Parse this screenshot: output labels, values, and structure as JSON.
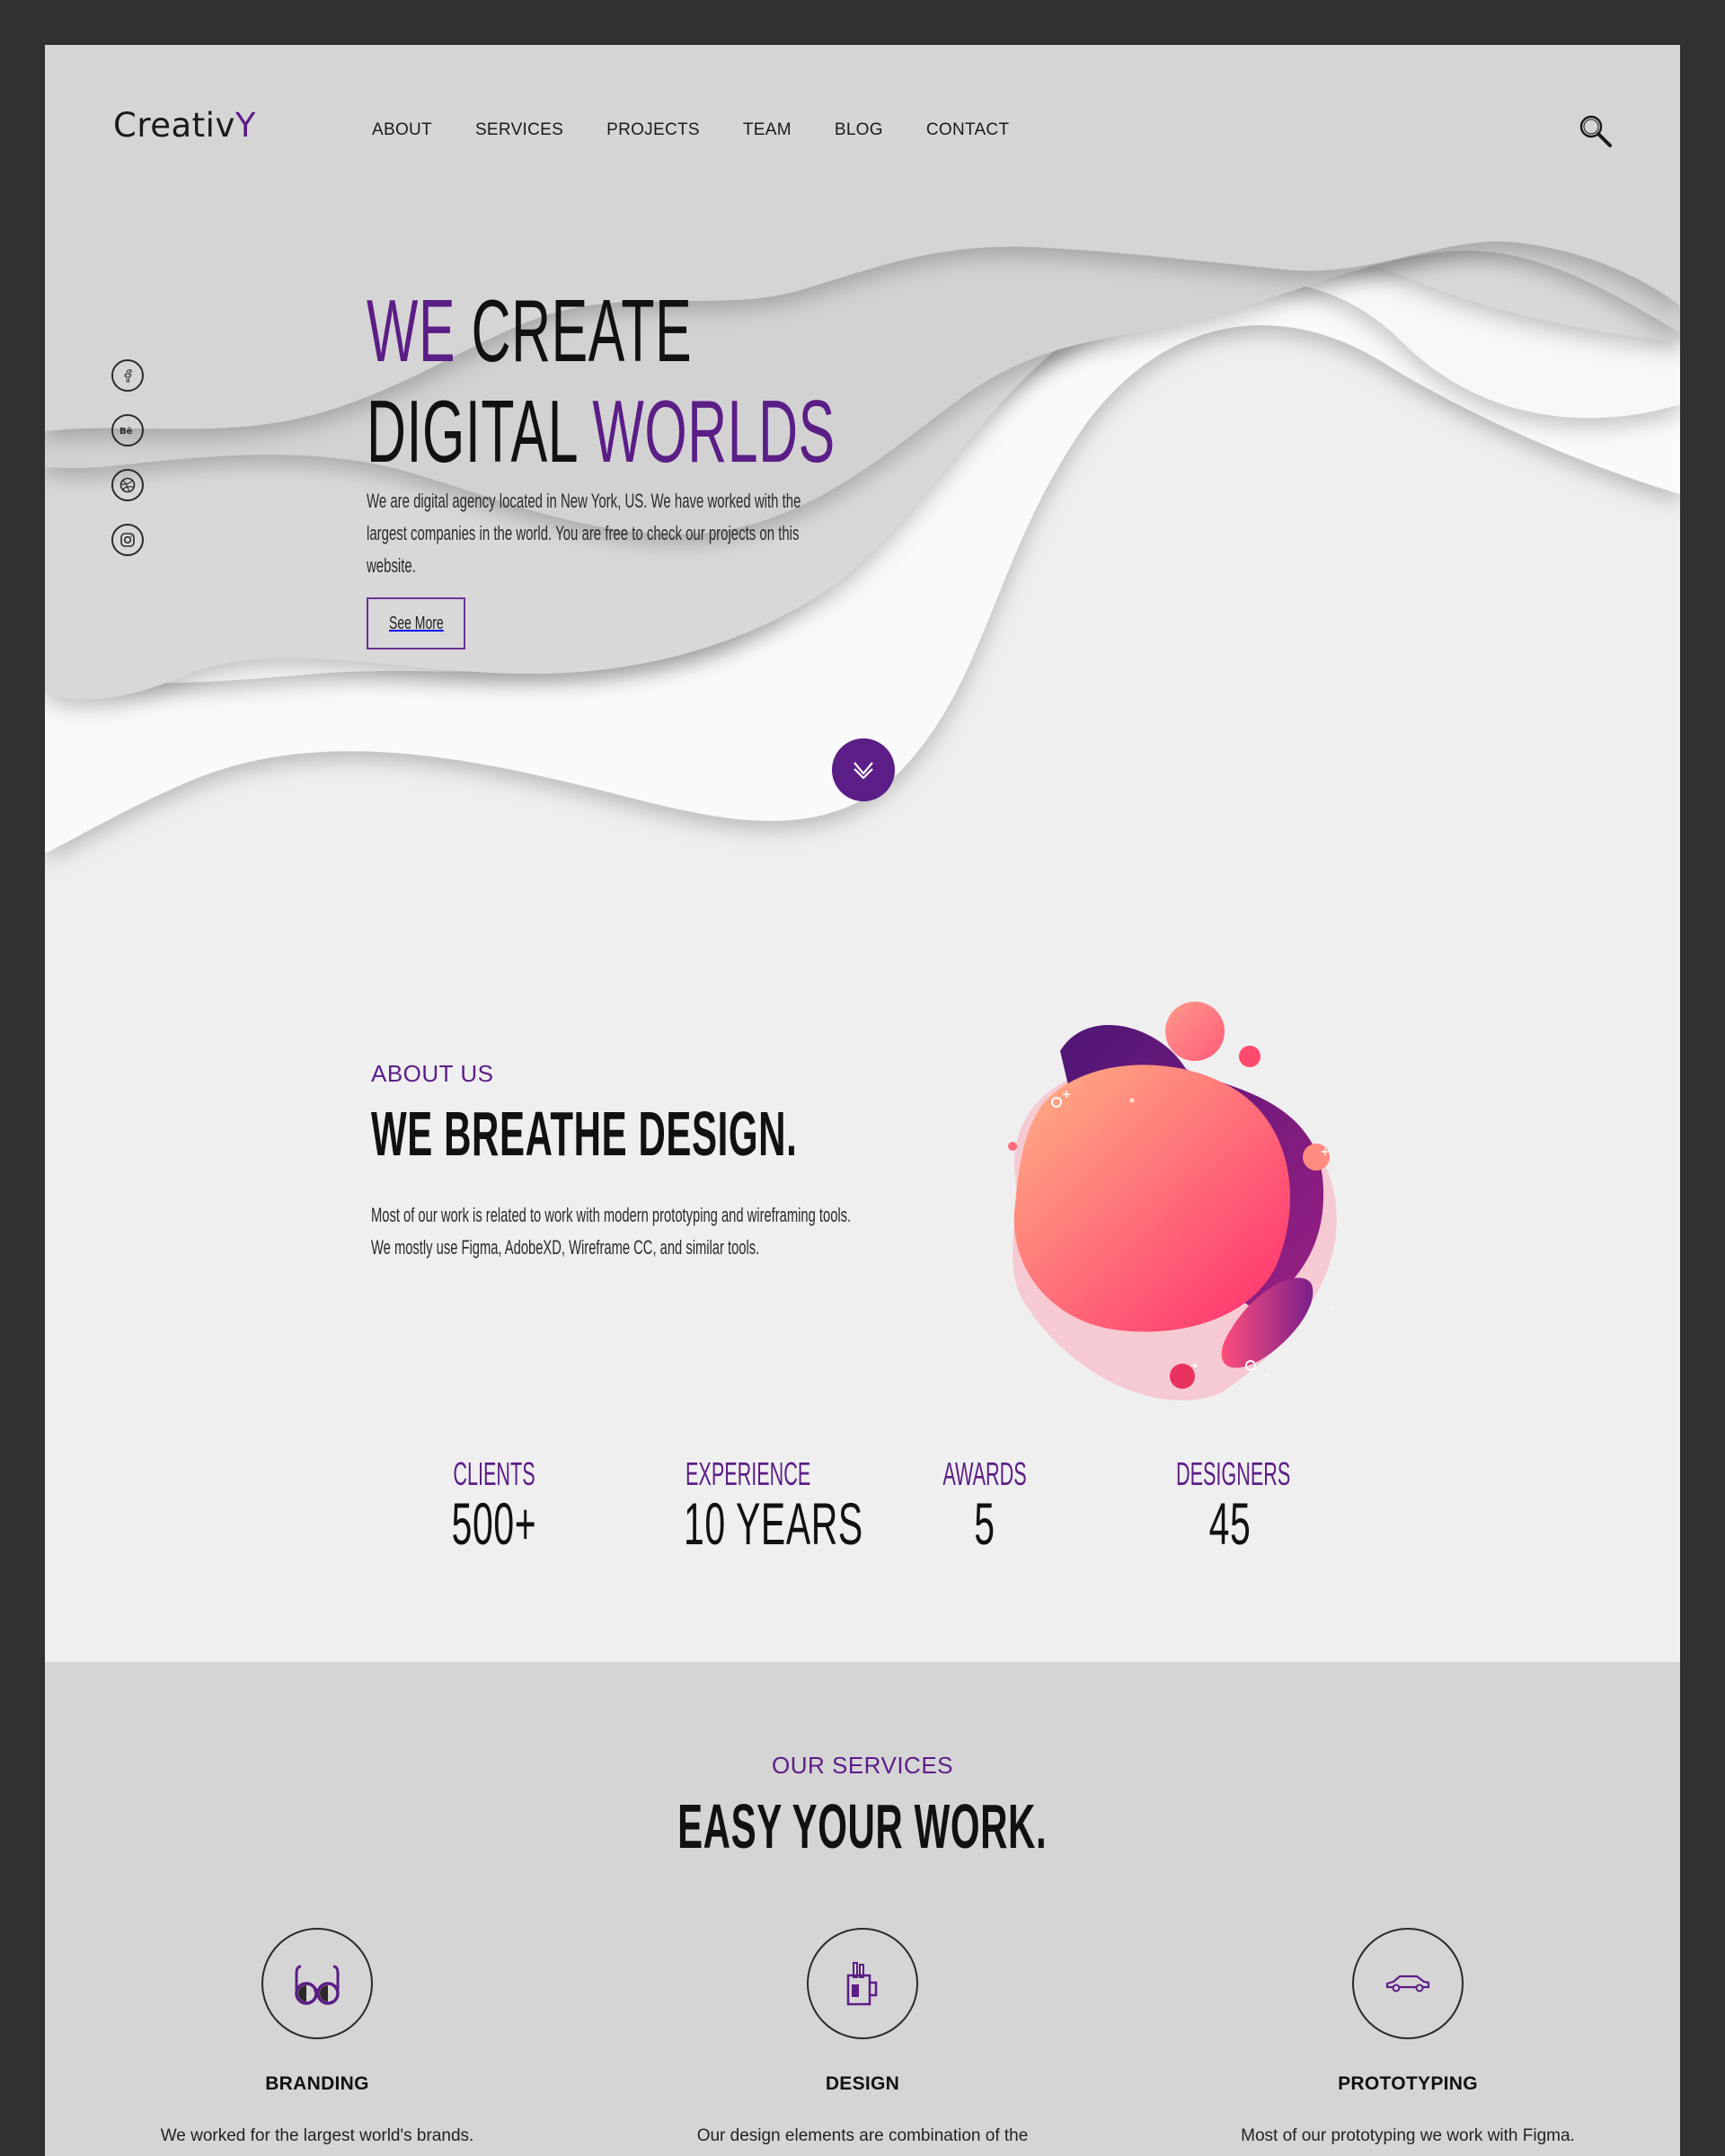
{
  "brand": {
    "logo_main": "Creativ",
    "logo_accent": "Y"
  },
  "nav": {
    "items": [
      "ABOUT",
      "SERVICES",
      "PROJECTS",
      "TEAM",
      "BLOG",
      "CONTACT"
    ]
  },
  "social": [
    "facebook-icon",
    "behance-icon",
    "dribbble-icon",
    "instagram-icon"
  ],
  "hero": {
    "line1_accent": "WE",
    "line1_rest": " CREATE",
    "line2_start": "DIGITAL ",
    "line2_accent": "WORLDS",
    "description": "We are digital agency located in New York, US. We have worked with the largest companies in the world. You are free to check our projects on this website.",
    "cta": "See More"
  },
  "about": {
    "label": "ABOUT US",
    "title": "WE BREATHE DESIGN.",
    "description": "Most of our work is related to work with modern prototyping and wireframing tools. We mostly use Figma, AdobeXD, Wireframe CC, and similar tools."
  },
  "stats": [
    {
      "label": "CLIENTS",
      "value": "500+"
    },
    {
      "label": "EXPERIENCE",
      "value": "10 YEARS"
    },
    {
      "label": "AWARDS",
      "value": "5"
    },
    {
      "label": "DESIGNERS",
      "value": "45"
    }
  ],
  "services": {
    "label": "OUR SERVICES",
    "title": "EASY YOUR WORK.",
    "items": [
      {
        "name": "BRANDING",
        "description": "We worked for the largest world's brands.",
        "icon": "glasses-icon"
      },
      {
        "name": "DESIGN",
        "description": "Our design elements are combination of the",
        "icon": "mug-icon"
      },
      {
        "name": "PROTOTYPING",
        "description": "Most of our prototyping we work with Figma.",
        "icon": "car-icon"
      }
    ]
  },
  "colors": {
    "accent": "#5b1d86",
    "frame": "#323132",
    "page": "#f0eff0",
    "services_bg": "#d6d5d6"
  }
}
